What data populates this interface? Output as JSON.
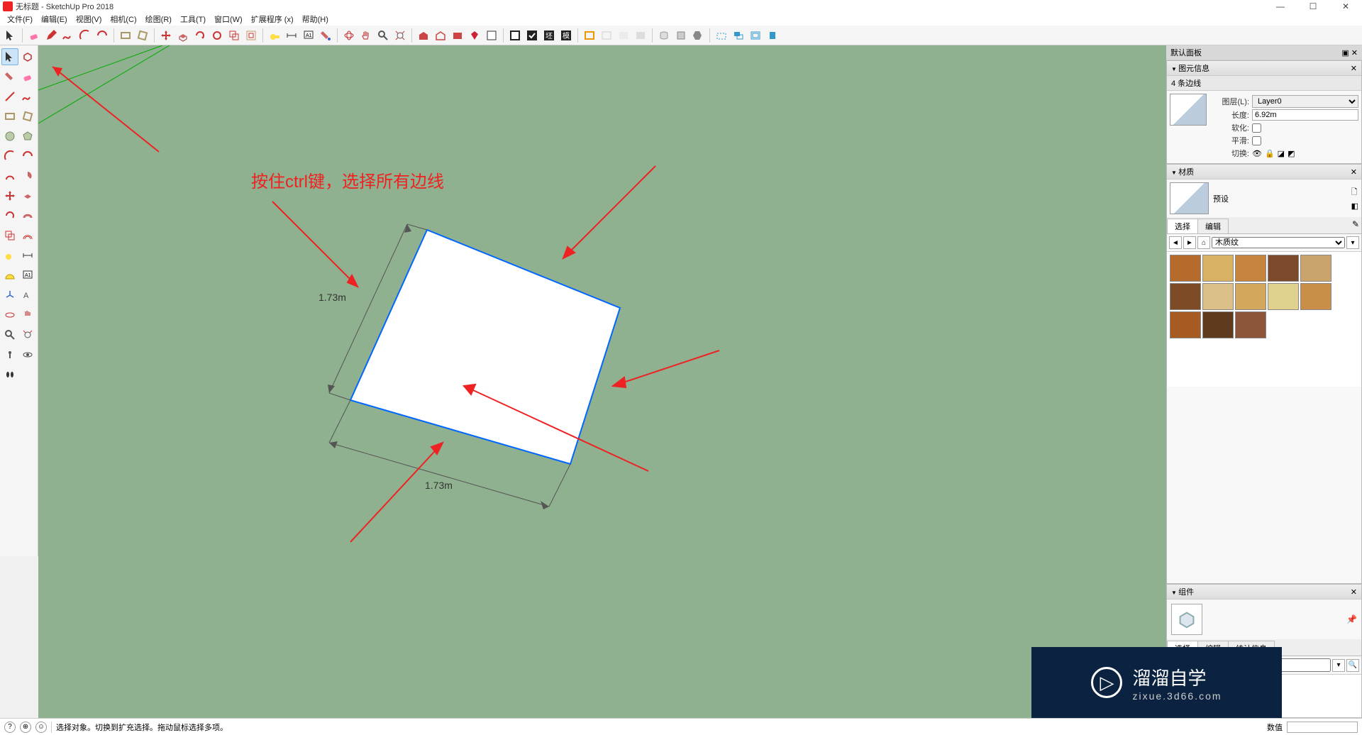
{
  "title": "无标题 - SketchUp Pro 2018",
  "menu": [
    "文件(F)",
    "编辑(E)",
    "视图(V)",
    "相机(C)",
    "绘图(R)",
    "工具(T)",
    "窗口(W)",
    "扩展程序 (x)",
    "帮助(H)"
  ],
  "annotation": "按住ctrl键，选择所有边线",
  "dims": {
    "a": "1.73m",
    "b": "1.73m"
  },
  "panels": {
    "default_title": "默认面板",
    "entity": {
      "title": "图元信息",
      "count": "4 条边线",
      "layer_label": "图层(L):",
      "layer_value": "Layer0",
      "length_label": "长度:",
      "length_value": "6.92m",
      "soften_label": "软化:",
      "smooth_label": "平滑:",
      "toggle_label": "切换:"
    },
    "materials": {
      "title": "材质",
      "preset": "预设",
      "tabs": {
        "select": "选择",
        "edit": "编辑"
      },
      "category": "木质纹",
      "swatches": [
        "#b46b2c",
        "#d9b162",
        "#c6853f",
        "#7a4a2a",
        "#caa46a",
        "#7d4b26",
        "#dcc08a",
        "#d2a85c",
        "#e0d18e",
        "#c98e48",
        "#a65b23",
        "#5e3a1e",
        "#8c563a"
      ]
    },
    "components": {
      "title": "组件",
      "tabs": {
        "select": "选择",
        "edit": "编辑",
        "stats": "统计信息"
      }
    }
  },
  "status": {
    "hint": "选择对象。切换到扩充选择。拖动鼠标选择多项。",
    "value_label": "数值"
  },
  "watermark": {
    "main": "溜溜自学",
    "sub": "zixue.3d66.com"
  }
}
